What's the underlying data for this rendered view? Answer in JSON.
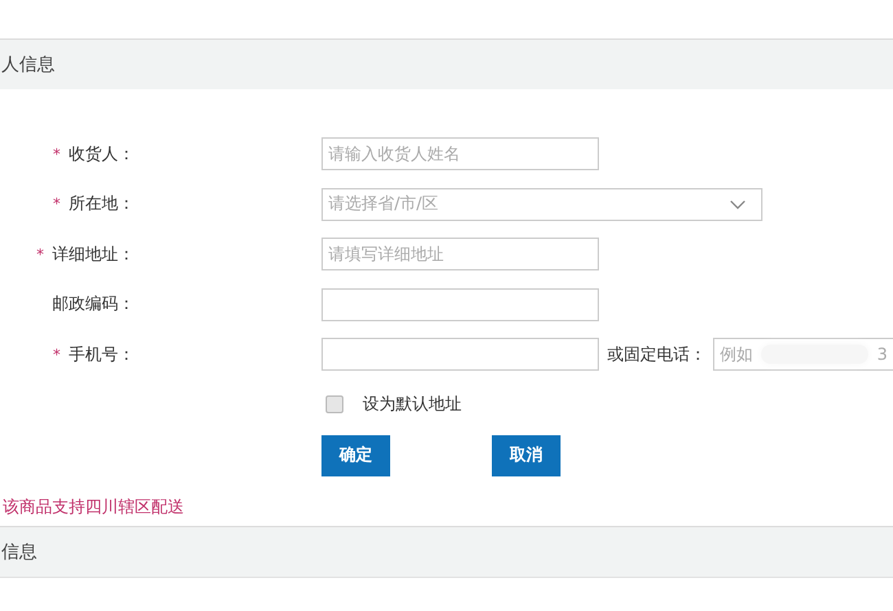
{
  "section_title": "人信息",
  "fields": [
    {
      "label": "收货人：",
      "required_mark": "*",
      "kind": "text",
      "placeholder": "请输入收货人姓名"
    },
    {
      "label": "所在地：",
      "required_mark": "*",
      "kind": "select",
      "placeholder": "请选择省/市/区"
    },
    {
      "label": "详细地址：",
      "required_mark": "*",
      "kind": "text",
      "placeholder": "请填写详细地址"
    },
    {
      "label": "邮政编码：",
      "kind": "text"
    },
    {
      "label": "手机号：",
      "required_mark": "*",
      "kind": "phone"
    }
  ],
  "landline": {
    "label": "或固定电话：",
    "placeholder_start": "例如",
    "placeholder_end": "3"
  },
  "default_address": {
    "label": "设为默认地址",
    "checked": false
  },
  "buttons": [
    {
      "label": "确定"
    },
    {
      "label": "取消"
    }
  ],
  "notice": "该商品支持四川辖区配送",
  "next_section_title": "信息"
}
